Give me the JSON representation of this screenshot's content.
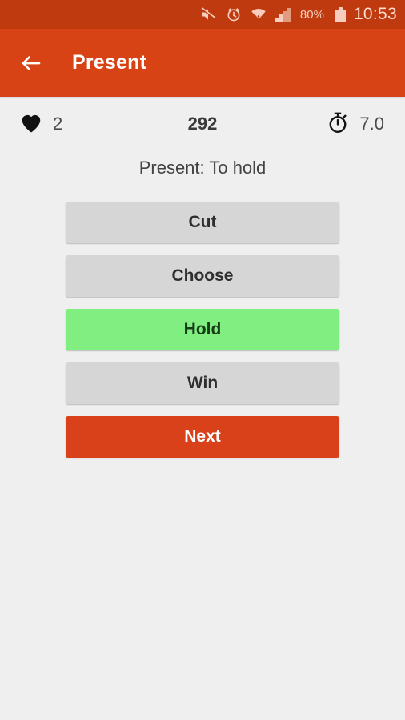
{
  "statusbar": {
    "icons": [
      "mute-icon",
      "alarm-icon",
      "wifi-icon",
      "signal-icon"
    ],
    "battery_label": "80%",
    "battery_icon": "battery-icon",
    "clock": "10:53"
  },
  "appbar": {
    "back_icon": "back-arrow-icon",
    "title": "Present",
    "background_color": "#d84315"
  },
  "stats": {
    "lives_icon": "heart-icon",
    "lives": "2",
    "score": "292",
    "timer_icon": "stopwatch-icon",
    "timer": "7.0"
  },
  "subtitle": "Present: To hold",
  "buttons": [
    {
      "label": "Cut",
      "style": "grey",
      "color": "#d6d6d6"
    },
    {
      "label": "Choose",
      "style": "grey",
      "color": "#d6d6d6"
    },
    {
      "label": "Hold",
      "style": "green",
      "color": "#81ee81"
    },
    {
      "label": "Win",
      "style": "grey",
      "color": "#d6d6d6"
    },
    {
      "label": "Next",
      "style": "orange",
      "color": "#d8411a"
    }
  ]
}
